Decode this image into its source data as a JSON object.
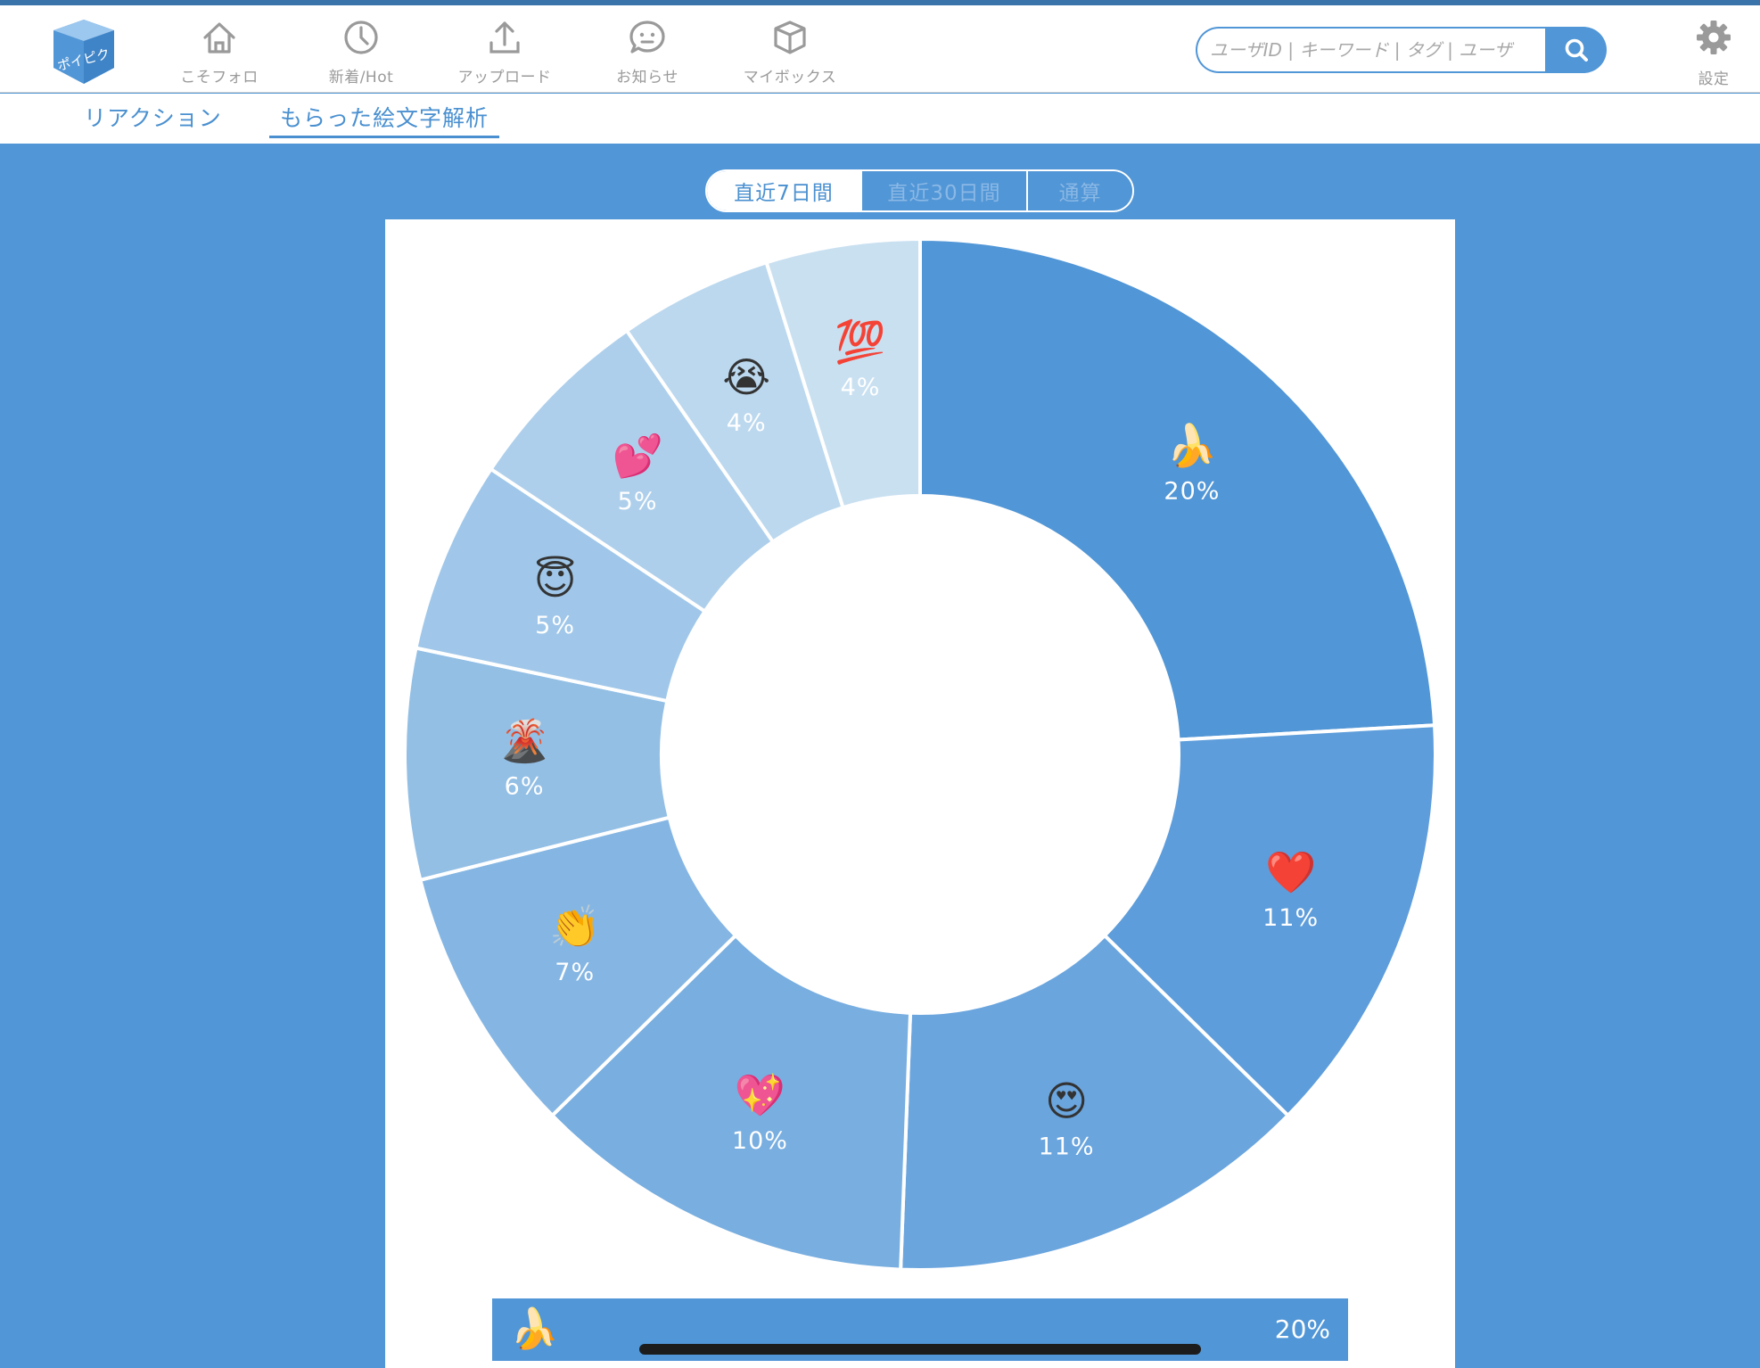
{
  "header": {
    "logo_text": "ポイピク",
    "nav": [
      {
        "label": "こそフォロ",
        "icon": "home-icon"
      },
      {
        "label": "新着/Hot",
        "icon": "clock-icon"
      },
      {
        "label": "アップロード",
        "icon": "upload-icon"
      },
      {
        "label": "お知らせ",
        "icon": "speech-bubble-icon"
      },
      {
        "label": "マイボックス",
        "icon": "box-icon"
      }
    ],
    "search": {
      "placeholder": "ユーザID | キーワード | タグ | ユーザ",
      "value": ""
    },
    "settings_label": "設定"
  },
  "subnav": {
    "tabs": [
      {
        "label": "リアクション",
        "active": false
      },
      {
        "label": "もらった絵文字解析",
        "active": true
      }
    ]
  },
  "period": {
    "options": [
      "直近7日間",
      "直近30日間",
      "通算"
    ],
    "selected": "直近7日間"
  },
  "chart_data": {
    "type": "pie",
    "donut": true,
    "start": "top, clockwise",
    "slices": [
      {
        "emoji": "🍌",
        "label": "20%",
        "value": 20,
        "color": "#5196d6"
      },
      {
        "emoji": "❤️",
        "label": "11%",
        "value": 11,
        "color": "#5d9ddb"
      },
      {
        "emoji": "😍",
        "label": "11%",
        "value": 11,
        "color": "#6aa5de"
      },
      {
        "emoji": "💖",
        "label": "10%",
        "value": 10,
        "color": "#78aee0"
      },
      {
        "emoji": "👏",
        "label": "7%",
        "value": 7,
        "color": "#85b6e3"
      },
      {
        "emoji": "🌋",
        "label": "6%",
        "value": 6,
        "color": "#93bfe5"
      },
      {
        "emoji": "😇",
        "label": "5%",
        "value": 5,
        "color": "#a0c7e9"
      },
      {
        "emoji": "💕",
        "label": "5%",
        "value": 5,
        "color": "#aecfeb"
      },
      {
        "emoji": "😭",
        "label": "4%",
        "value": 4,
        "color": "#bcd8ee"
      },
      {
        "emoji": "💯",
        "label": "4%",
        "value": 4,
        "color": "#c9e0f1"
      }
    ]
  },
  "rows": [
    {
      "emoji": "🍌",
      "percent": "20%"
    }
  ],
  "colors": {
    "accent": "#5196d6",
    "header_stripe": "#3a72aa"
  }
}
